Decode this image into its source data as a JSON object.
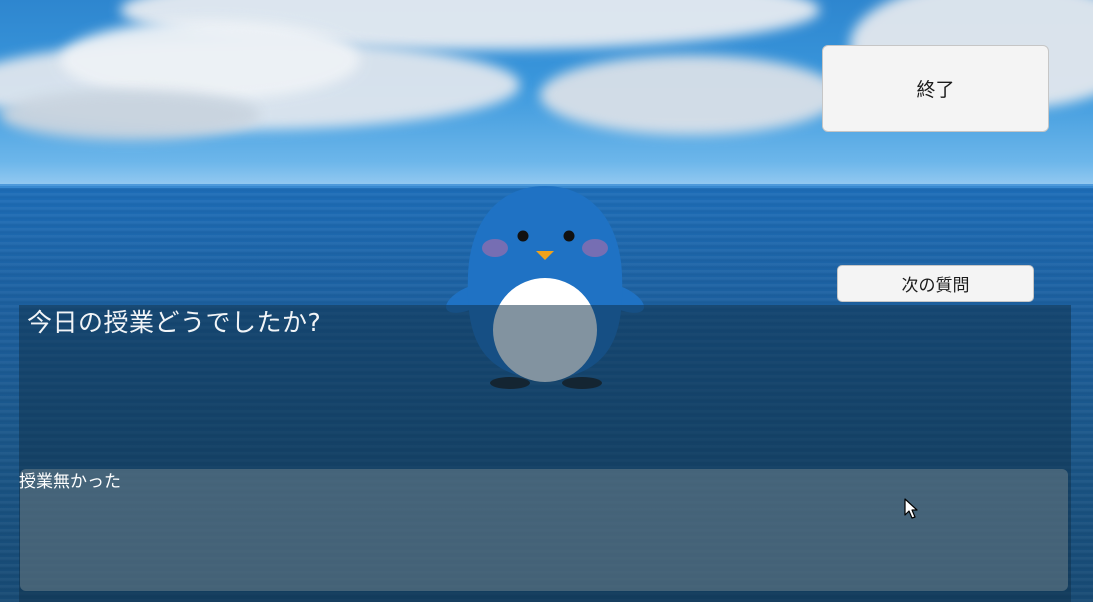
{
  "buttons": {
    "end_label": "終了",
    "next_question_label": "次の質問"
  },
  "dialog": {
    "question": "今日の授業どうでしたか?",
    "answer": "授業無かった"
  },
  "colors": {
    "penguin_body": "#1f72c4",
    "penguin_belly": "#ffffff",
    "beak": "#f0a21b",
    "sky": "#3a97dc",
    "sea": "#1c5f9e"
  },
  "icons": {
    "character": "penguin",
    "pointer": "mouse-cursor"
  }
}
